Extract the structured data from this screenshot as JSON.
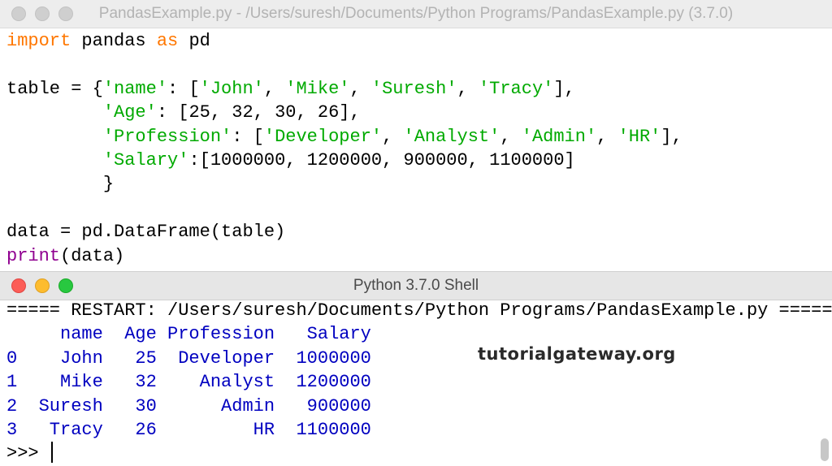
{
  "editor": {
    "title": "PandasExample.py - /Users/suresh/Documents/Python Programs/PandasExample.py (3.7.0)",
    "lines": [
      {
        "code": [
          {
            "t": "import",
            "k": "kw"
          },
          {
            "t": " pandas ",
            "k": "tx"
          },
          {
            "t": "as",
            "k": "kw"
          },
          {
            "t": " pd",
            "k": "tx"
          }
        ]
      },
      {
        "code": []
      },
      {
        "code": [
          {
            "t": "table = {",
            "k": "tx"
          },
          {
            "t": "'name'",
            "k": "str"
          },
          {
            "t": ": [",
            "k": "tx"
          },
          {
            "t": "'John'",
            "k": "str"
          },
          {
            "t": ", ",
            "k": "tx"
          },
          {
            "t": "'Mike'",
            "k": "str"
          },
          {
            "t": ", ",
            "k": "tx"
          },
          {
            "t": "'Suresh'",
            "k": "str"
          },
          {
            "t": ", ",
            "k": "tx"
          },
          {
            "t": "'Tracy'",
            "k": "str"
          },
          {
            "t": "],",
            "k": "tx"
          }
        ]
      },
      {
        "code": [
          {
            "t": "         ",
            "k": "tx"
          },
          {
            "t": "'Age'",
            "k": "str"
          },
          {
            "t": ": [25, 32, 30, 26],",
            "k": "tx"
          }
        ]
      },
      {
        "code": [
          {
            "t": "         ",
            "k": "tx"
          },
          {
            "t": "'Profession'",
            "k": "str"
          },
          {
            "t": ": [",
            "k": "tx"
          },
          {
            "t": "'Developer'",
            "k": "str"
          },
          {
            "t": ", ",
            "k": "tx"
          },
          {
            "t": "'Analyst'",
            "k": "str"
          },
          {
            "t": ", ",
            "k": "tx"
          },
          {
            "t": "'Admin'",
            "k": "str"
          },
          {
            "t": ", ",
            "k": "tx"
          },
          {
            "t": "'HR'",
            "k": "str"
          },
          {
            "t": "],",
            "k": "tx"
          }
        ]
      },
      {
        "code": [
          {
            "t": "         ",
            "k": "tx"
          },
          {
            "t": "'Salary'",
            "k": "str"
          },
          {
            "t": ":[1000000, 1200000, 900000, 1100000]",
            "k": "tx"
          }
        ]
      },
      {
        "code": [
          {
            "t": "         }",
            "k": "tx"
          }
        ]
      },
      {
        "code": []
      },
      {
        "code": [
          {
            "t": "data = pd.DataFrame(table)",
            "k": "tx"
          }
        ]
      },
      {
        "code": [
          {
            "t": "print",
            "k": "bi"
          },
          {
            "t": "(data)",
            "k": "tx"
          }
        ]
      }
    ]
  },
  "shell": {
    "title": "Python 3.7.0 Shell",
    "restart_line": "===== RESTART: /Users/suresh/Documents/Python Programs/PandasExample.py =====",
    "output_lines": [
      "     name  Age Profession   Salary",
      "0    John   25  Developer  1000000",
      "1    Mike   32    Analyst  1200000",
      "2  Suresh   30      Admin   900000",
      "3   Tracy   26         HR  1100000"
    ],
    "prompt": ">>> "
  },
  "watermark": "tutorialgateway.org",
  "colors": {
    "keyword": "#ff7700",
    "string": "#00aa00",
    "builtin": "#900090",
    "output": "#0000c0"
  }
}
